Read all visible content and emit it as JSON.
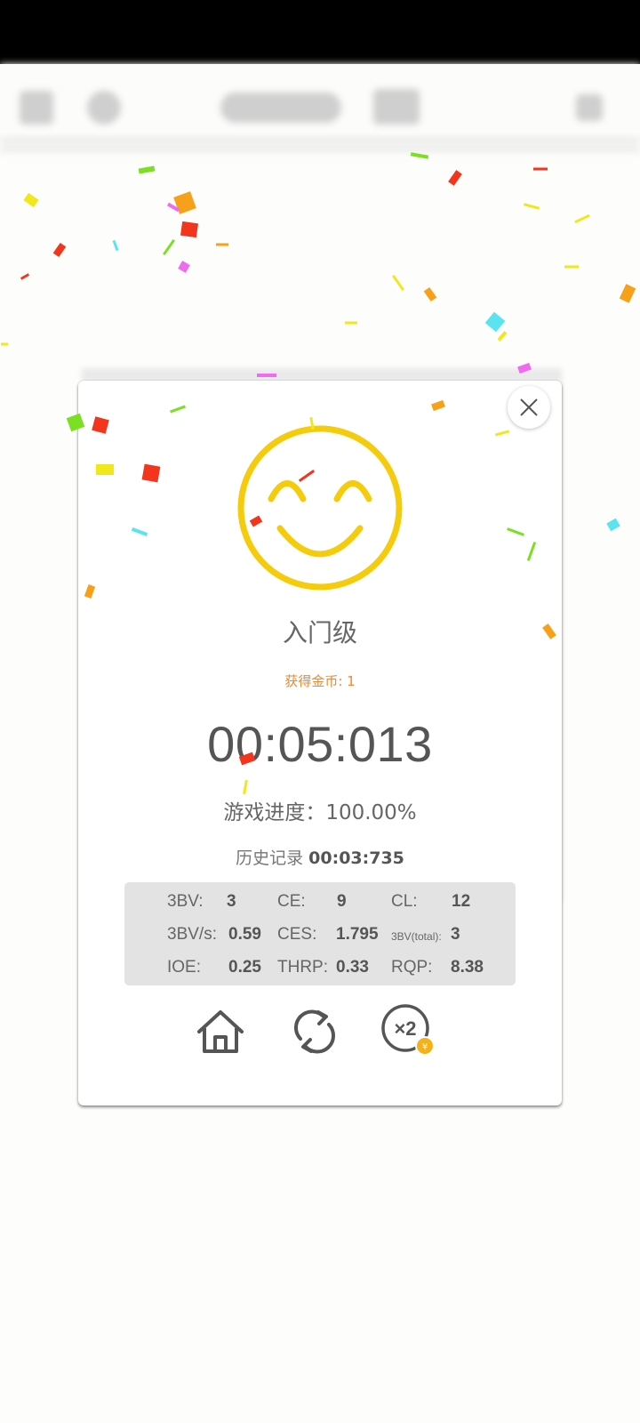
{
  "dialog": {
    "level_title": "入门级",
    "coins_text": "获得金币: 1",
    "timer": "00:05:013",
    "progress_label": "游戏进度：",
    "progress_value": "100.00%",
    "history_label": "历史记录",
    "history_value": "00:03:735",
    "multiplier_label": "×2"
  },
  "stats": [
    {
      "label": "3BV:",
      "value": "3"
    },
    {
      "label": "CE:",
      "value": "9"
    },
    {
      "label": "CL:",
      "value": "12"
    },
    {
      "label": "3BV/s:",
      "value": "0.59"
    },
    {
      "label": "CES:",
      "value": "1.795"
    },
    {
      "label": "3BV(total):",
      "value": "3"
    },
    {
      "label": "IOE:",
      "value": "0.25"
    },
    {
      "label": "THRP:",
      "value": "0.33"
    },
    {
      "label": "RQP:",
      "value": "8.38"
    }
  ],
  "colors": {
    "smiley": "#f5cc0c",
    "coins_text": "#f5862a",
    "coin_badge": "#f3b21c"
  },
  "icons": [
    "close-icon",
    "smiley-face-icon",
    "home-icon",
    "restart-icon",
    "double-coins-icon",
    "coin-icon"
  ]
}
